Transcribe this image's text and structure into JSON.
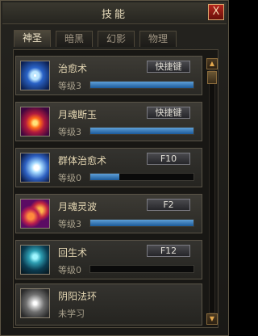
{
  "window": {
    "title": "技能",
    "close_label": "X"
  },
  "tabs": [
    {
      "label": "神圣",
      "active": true
    },
    {
      "label": "暗黑",
      "active": false
    },
    {
      "label": "幻影",
      "active": false
    },
    {
      "label": "物理",
      "active": false
    }
  ],
  "scroll": {
    "up": "▲",
    "down": "▼"
  },
  "skills": [
    {
      "name": "治愈术",
      "level": "等级3",
      "hotkey": "快捷键",
      "progress": 1.0,
      "icon": "heal-icon"
    },
    {
      "name": "月魂断玉",
      "level": "等级3",
      "hotkey": "快捷键",
      "progress": 1.0,
      "icon": "moon-soul-icon"
    },
    {
      "name": "群体治愈术",
      "level": "等级0",
      "hotkey": "F10",
      "progress": 0.28,
      "icon": "mass-heal-icon"
    },
    {
      "name": "月魂灵波",
      "level": "等级3",
      "hotkey": "F2",
      "progress": 1.0,
      "icon": "soul-wave-icon"
    },
    {
      "name": "回生术",
      "level": "等级0",
      "hotkey": "F12",
      "progress": 0.0,
      "icon": "revive-icon"
    },
    {
      "name": "阴阳法环",
      "level": "未学习",
      "icon": "yin-yang-icon"
    }
  ],
  "colors": {
    "accent": "#e6d8b4",
    "progress": "#3b84c8",
    "close": "#b3261c"
  }
}
